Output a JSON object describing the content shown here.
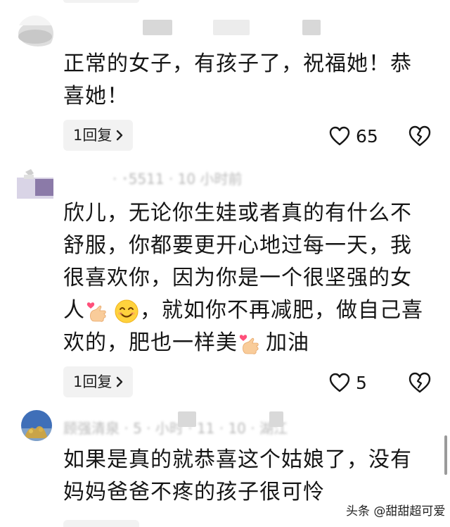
{
  "comments": [
    {
      "lines": [
        "正常的女子，有孩子了，祝福她！恭",
        "喜她！"
      ],
      "reply_label": "1回复",
      "like_count": "65"
    },
    {
      "meta": "· ･5511 · 10 小时前",
      "lines": [
        "欣儿，无论你生娃或者真的有什么不",
        "舒服，你都要更开心地过每一天，我",
        "很喜欢你，因为你是一个很坚强的女"
      ],
      "line4_a": "人",
      "line4_b": "，就如你不再减肥，做自己喜",
      "line5_a": "欢的，肥也一样美",
      "line5_b": "加油",
      "reply_label": "1回复",
      "like_count": "5"
    },
    {
      "meta": "顾强清泉 · 5 · 小时 · 11 · 10 · 湖江",
      "lines": [
        "如果是真的就恭喜这个姑娘了，没有",
        "妈妈爸爸不疼的孩子很可怜"
      ]
    }
  ],
  "watermark": "头条 @甜甜超可爱",
  "icons": [
    "chevron-right-icon",
    "heart-icon",
    "broken-heart-icon",
    "heart-hand-emoji",
    "smile-emoji"
  ],
  "colors": {
    "reply_bg": "#f2f2f2",
    "meta_gray": "#b8b8b8",
    "text": "#161616"
  }
}
